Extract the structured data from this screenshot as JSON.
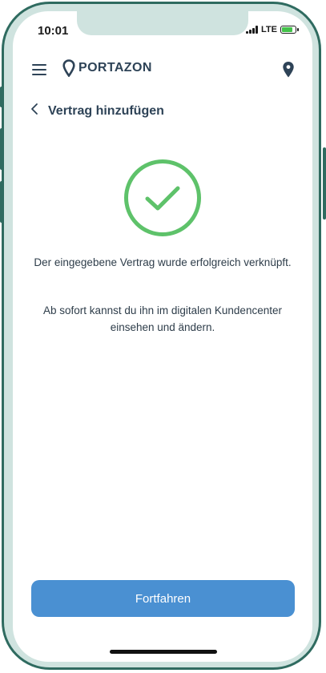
{
  "status_bar": {
    "time": "10:01",
    "network": "LTE"
  },
  "header": {
    "brand": "PORTAZON"
  },
  "page": {
    "title": "Vertrag hinzufügen"
  },
  "success": {
    "message_line1": "Der eingegebene Vertrag wurde erfolgreich verknüpft.",
    "message_line2": "Ab sofort kannst du ihn im digitalen Kundencenter einsehen und ändern."
  },
  "actions": {
    "continue_label": "Fortfahren"
  },
  "colors": {
    "brand_dark": "#2e4357",
    "success_green": "#5ec26a",
    "button_blue": "#4a90d2",
    "device_frame": "#2f6b60"
  }
}
